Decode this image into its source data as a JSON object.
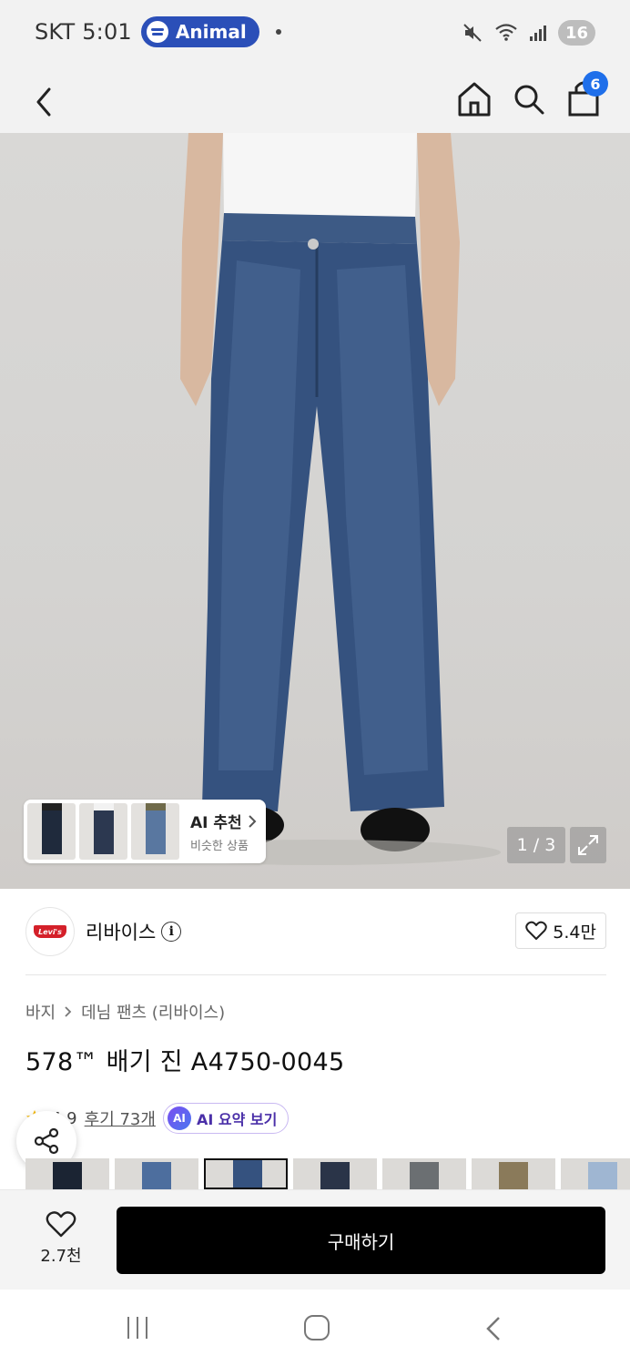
{
  "status_bar": {
    "carrier_time": "SKT 5:01",
    "media_pill": "Animal",
    "battery": "16"
  },
  "top_nav": {
    "cart_count": "6"
  },
  "hero": {
    "ai_recommend_title": "AI 추천",
    "ai_recommend_sub": "비슷한 상품",
    "pager": "1 / 3"
  },
  "brand": {
    "name": "리바이스",
    "logo_text": "Levi's",
    "likes": "5.4만"
  },
  "breadcrumb": {
    "category": "바지",
    "subcategory": "데님 팬츠 (리바이스)"
  },
  "product": {
    "title": "578™ 배기 진 A4750-0045",
    "rating": "4.9",
    "reviews": "후기 73개",
    "ai_summary": "AI 요약 보기",
    "ai_badge": "AI"
  },
  "action_bar": {
    "wish_count": "2.7천",
    "buy_label": "구매하기"
  },
  "colors": {
    "accent_blue": "#1f6fea",
    "spotify_pill": "#2b4fb8",
    "buy_button": "#000000",
    "ai_purple": "#4a2fa8"
  }
}
